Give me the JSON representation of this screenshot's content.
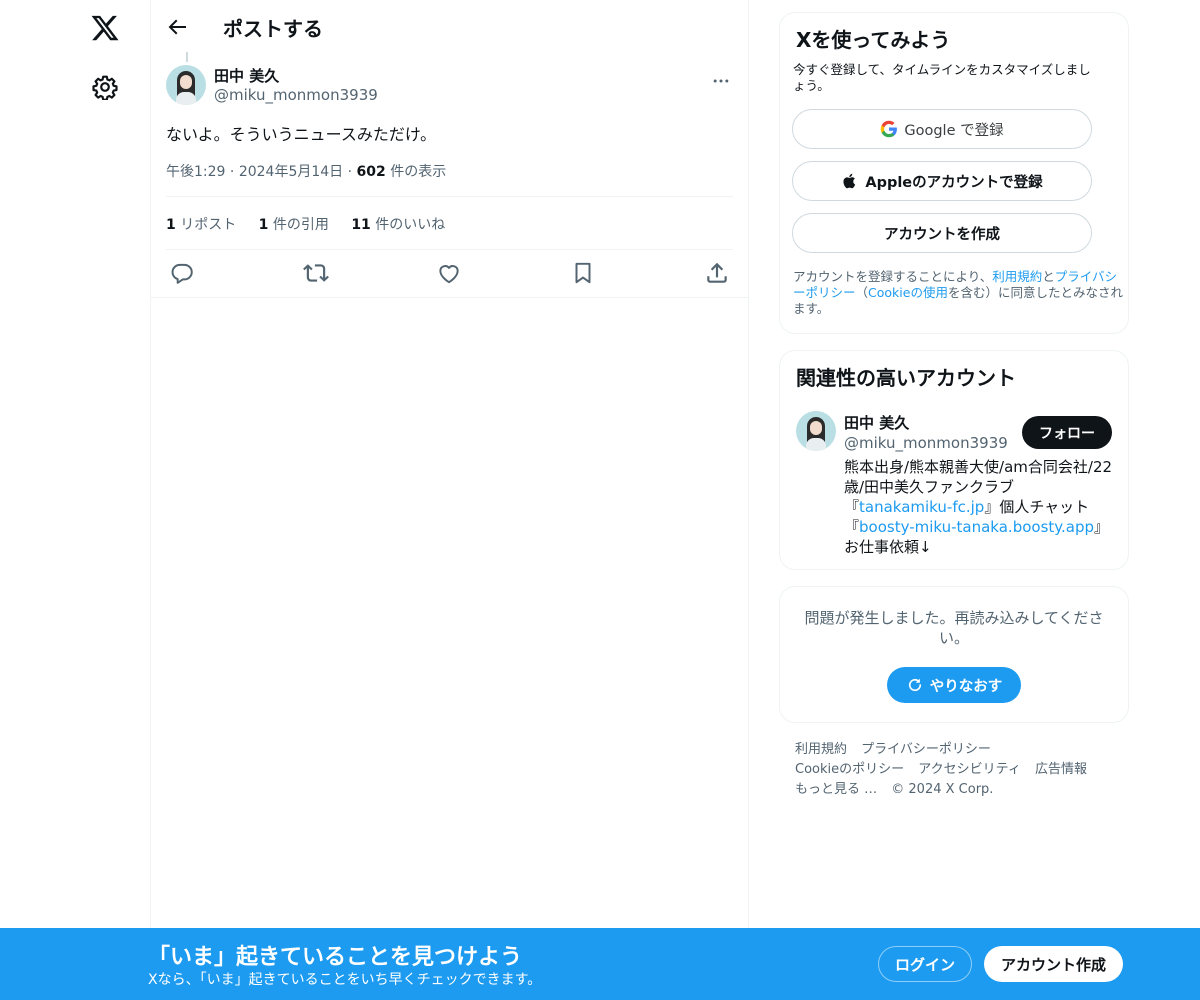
{
  "nav": {
    "logo_icon": "x-logo-icon",
    "settings_icon": "gear-icon"
  },
  "header": {
    "back_icon": "arrow-left-icon",
    "title": "ポストする"
  },
  "post": {
    "author_name": "田中 美久",
    "author_handle": "@miku_monmon3939",
    "text": "ないよ。そういうニュースみただけ。",
    "time": "午後1:29",
    "date": "2024年5月14日",
    "views_count": "602",
    "views_label": "件の表示",
    "reposts_count": "1",
    "reposts_label": "リポスト",
    "quotes_count": "1",
    "quotes_label": "件の引用",
    "likes_count": "11",
    "likes_label": "件のいいね",
    "actions": [
      "reply-icon",
      "repost-icon",
      "like-icon",
      "bookmark-icon",
      "share-icon"
    ]
  },
  "signup": {
    "title": "Xを使ってみよう",
    "subtitle": "今すぐ登録して、タイムラインをカスタマイズしましょう。",
    "google_label": "Google で登録",
    "apple_label": "Appleのアカウントで登録",
    "create_label": "アカウントを作成",
    "terms_prefix": "アカウントを登録することにより、",
    "terms_link": "利用規約",
    "terms_and": "と",
    "privacy_link": "プライバシーポリシー",
    "terms_mid": "（",
    "cookie_link": "Cookieの使用",
    "terms_suffix": "を含む）に同意したとみなされます。"
  },
  "related": {
    "title": "関連性の高いアカウント",
    "name": "田中 美久",
    "handle": "@miku_monmon3939",
    "follow_label": "フォロー",
    "bio_1": "熊本出身/熊本親善大使/am合同会社/22歳/田中美久ファンクラブ『",
    "bio_link_1": "tanakamiku-fc.jp",
    "bio_2": "』個人チャット『",
    "bio_link_2": "boosty-miku-tanaka.boosty.app",
    "bio_3": "』お仕事依頼↓"
  },
  "error": {
    "message": "問題が発生しました。再読み込みしてください。",
    "retry_label": "やりなおす"
  },
  "footer": {
    "terms": "利用規約",
    "privacy": "プライバシーポリシー",
    "cookie": "Cookieのポリシー",
    "accessibility": "アクセシビリティ",
    "ads": "広告情報",
    "more": "もっと見る …",
    "copyright": "© 2024 X Corp."
  },
  "banner": {
    "title": "「いま」起きていることを見つけよう",
    "subtitle": "Xなら、「いま」起きていることをいち早くチェックできます。",
    "login_label": "ログイン",
    "signup_label": "アカウント作成"
  },
  "colors": {
    "accent": "#1d9bf0",
    "text": "#0f1419",
    "muted": "#536471"
  }
}
